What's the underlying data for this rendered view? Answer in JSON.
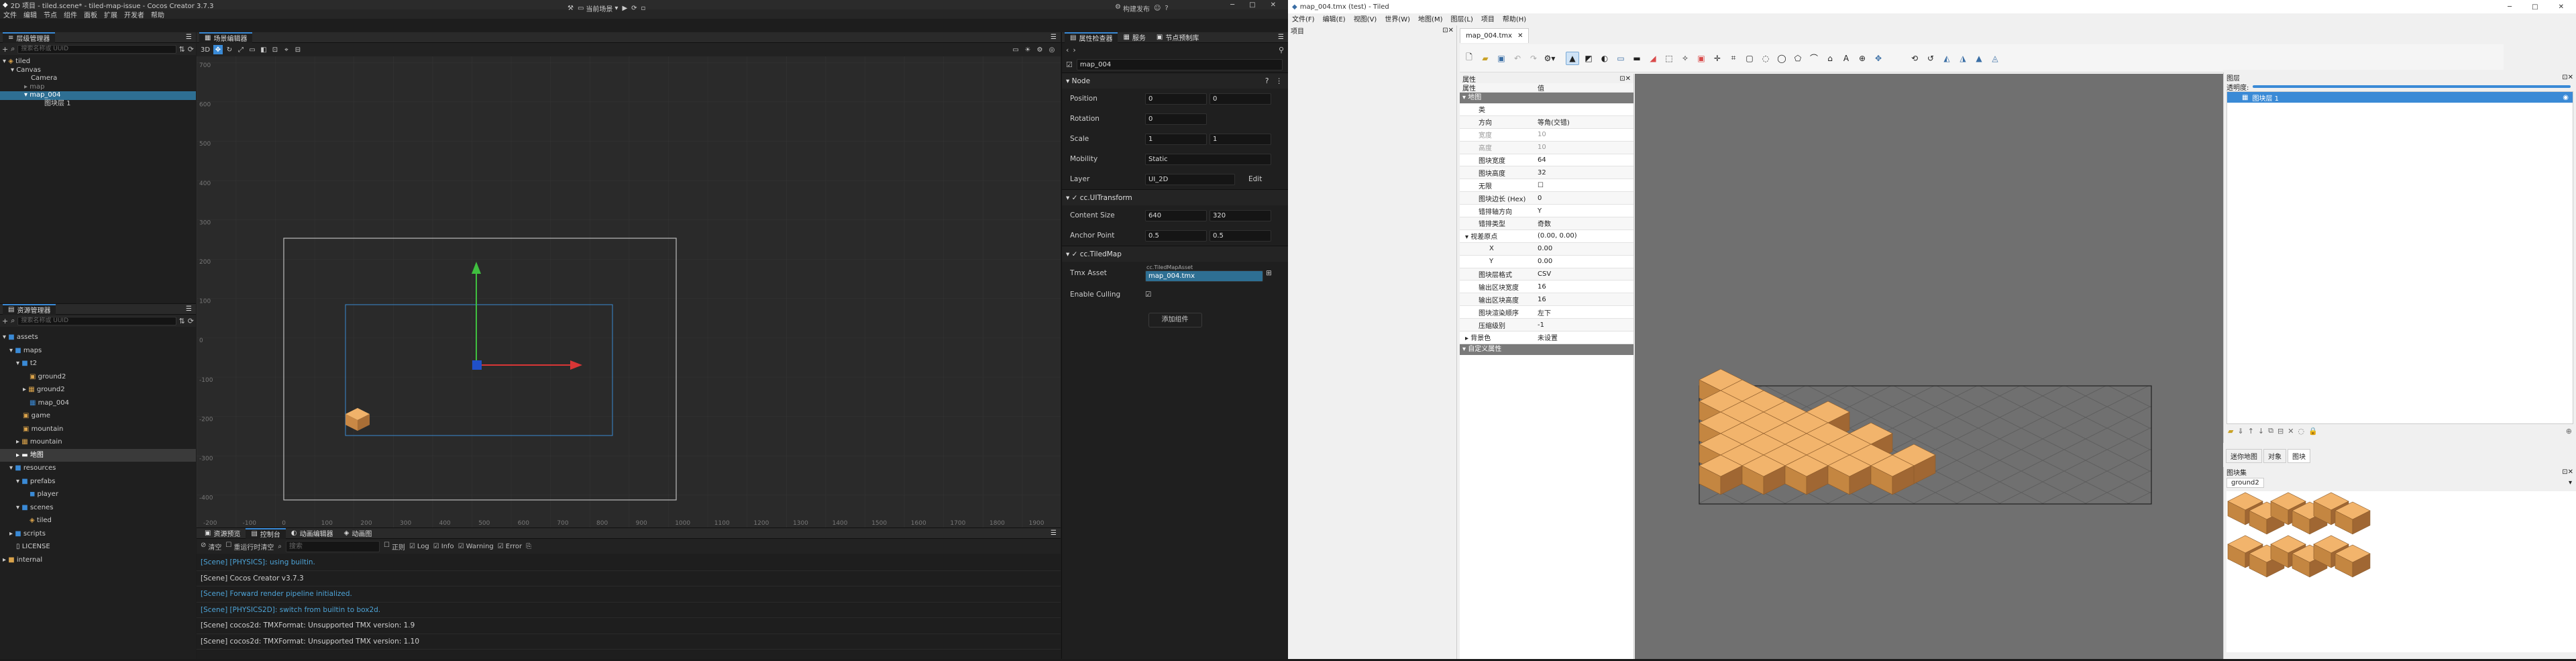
{
  "cocos": {
    "title": "2D 项目 - tiled.scene* - tiled-map-issue - Cocos Creator 3.7.3",
    "menu": [
      "文件",
      "编辑",
      "节点",
      "组件",
      "面板",
      "扩展",
      "开发者",
      "帮助"
    ],
    "scene_select": "当前场景",
    "publish": "构建发布",
    "hierarchy": {
      "title": "层级管理器",
      "search": "搜索名称或 UUID",
      "items": [
        {
          "label": "tiled",
          "lvl": 0
        },
        {
          "label": "Canvas",
          "lvl": 1
        },
        {
          "label": "Camera",
          "lvl": 2
        },
        {
          "label": "map",
          "lvl": 2
        },
        {
          "label": "map_004",
          "lvl": 2,
          "sel": true
        },
        {
          "label": "图块层 1",
          "lvl": 3
        }
      ]
    },
    "scene": {
      "title": "场景编辑器",
      "mode": "3D",
      "yticks": [
        "700",
        "600",
        "500",
        "400",
        "300",
        "200",
        "100",
        "0",
        "-100",
        "-200",
        "-300",
        "-400",
        "-500",
        "-600",
        "-700"
      ],
      "xticks": [
        "-200",
        "-100",
        "0",
        "100",
        "200",
        "300",
        "400",
        "500",
        "600",
        "700",
        "800",
        "900",
        "1000",
        "1100",
        "1200",
        "1300",
        "1400",
        "1500",
        "1600",
        "1700",
        "1800",
        "1900"
      ]
    },
    "assets": {
      "title": "资源管理器",
      "search": "搜索名称或 UUID",
      "items": [
        {
          "label": "assets",
          "lvl": 0
        },
        {
          "label": "maps",
          "lvl": 1
        },
        {
          "label": "t2",
          "lvl": 2
        },
        {
          "label": "ground2",
          "lvl": 3
        },
        {
          "label": "ground2",
          "lvl": 3
        },
        {
          "label": "map_004",
          "lvl": 3
        },
        {
          "label": "game",
          "lvl": 2
        },
        {
          "label": "mountain",
          "lvl": 2
        },
        {
          "label": "mountain",
          "lvl": 2
        },
        {
          "label": "地图",
          "lvl": 2,
          "sel": true
        },
        {
          "label": "resources",
          "lvl": 1
        },
        {
          "label": "prefabs",
          "lvl": 2
        },
        {
          "label": "player",
          "lvl": 3
        },
        {
          "label": "scenes",
          "lvl": 2
        },
        {
          "label": "tiled",
          "lvl": 3
        },
        {
          "label": "scripts",
          "lvl": 1
        },
        {
          "label": "LICENSE",
          "lvl": 1
        },
        {
          "label": "internal",
          "lvl": 0
        }
      ]
    },
    "console": {
      "tabs": [
        "资源预览",
        "控制台",
        "动画编辑器",
        "动画图"
      ],
      "clear": "清空",
      "clear_on_run": "重运行时清空",
      "search": "搜索",
      "regex": "正则",
      "filters": [
        "Log",
        "Info",
        "Warning",
        "Error"
      ],
      "logs": [
        {
          "text": "[Scene] [PHYSICS]: using builtin.",
          "c": "#4da3d6"
        },
        {
          "text": "[Scene] Cocos Creator v3.7.3",
          "c": "#cfcfcf"
        },
        {
          "text": "[Scene] Forward render pipeline initialized.",
          "c": "#4da3d6"
        },
        {
          "text": "[Scene] [PHYSICS2D]: switch from builtin to box2d.",
          "c": "#4da3d6"
        },
        {
          "text": "[Scene] cocos2d: TMXFormat: Unsupported TMX version: 1.9",
          "c": "#cfcfcf"
        },
        {
          "text": "[Scene] cocos2d: TMXFormat: Unsupported TMX version: 1.10",
          "c": "#cfcfcf"
        }
      ]
    },
    "inspector": {
      "tabs": [
        "属性检查器",
        "服务",
        "节点预制库"
      ],
      "node_name": "map_004",
      "node_section": "Node",
      "position": [
        "0",
        "0"
      ],
      "rotation": "0",
      "scale": [
        "1",
        "1"
      ],
      "mobility": "Static",
      "layer": "UI_2D",
      "edit": "Edit",
      "uitransform": "cc.UITransform",
      "content_size": [
        "640",
        "320"
      ],
      "anchor": [
        "0.5",
        "0.5"
      ],
      "tiledmap": "cc.TiledMap",
      "tmx_label": "Tmx Asset",
      "tmx_small": "cc.TiledMapAsset",
      "tmx_value": "map_004.tmx",
      "culling": "Enable Culling",
      "add_component": "添加组件",
      "labels": {
        "position": "Position",
        "rotation": "Rotation",
        "scale": "Scale",
        "mobility": "Mobility",
        "layer": "Layer",
        "content_size": "Content Size",
        "anchor": "Anchor Point",
        "w": "W",
        "h": "H",
        "x": "X",
        "y": "Y"
      }
    }
  },
  "tiled": {
    "title": "map_004.tmx (test) - Tiled",
    "menu": [
      "文件(F)",
      "编辑(E)",
      "视图(V)",
      "世界(W)",
      "地图(M)",
      "图层(L)",
      "项目",
      "帮助(H)"
    ],
    "project": "项目",
    "doc_tab": "map_004.tmx",
    "props": {
      "title": "属性",
      "col_k": "属性",
      "col_v": "值",
      "section": "地图",
      "custom": "自定义属性",
      "rows": [
        {
          "k": "类",
          "v": ""
        },
        {
          "k": "方向",
          "v": "等角(交错)"
        },
        {
          "k": "宽度",
          "v": "10",
          "dis": true
        },
        {
          "k": "高度",
          "v": "10",
          "dis": true
        },
        {
          "k": "图块宽度",
          "v": "64"
        },
        {
          "k": "图块高度",
          "v": "32"
        },
        {
          "k": "无限",
          "v": "☐"
        },
        {
          "k": "图块边长 (Hex)",
          "v": "0"
        },
        {
          "k": "错排轴方向",
          "v": "Y"
        },
        {
          "k": "错排类型",
          "v": "奇数"
        },
        {
          "k": "▾ 视差原点",
          "v": "(0.00, 0.00)"
        },
        {
          "k": "X",
          "v": "0.00",
          "ind": true
        },
        {
          "k": "Y",
          "v": "0.00",
          "ind": true
        },
        {
          "k": "图块层格式",
          "v": "CSV"
        },
        {
          "k": "输出区块宽度",
          "v": "16"
        },
        {
          "k": "输出区块高度",
          "v": "16"
        },
        {
          "k": "图块渲染顺序",
          "v": "左下"
        },
        {
          "k": "压缩级别",
          "v": "-1"
        },
        {
          "k": "▸ 背景色",
          "v": "未设置"
        }
      ]
    },
    "layers": {
      "title": "图层",
      "opacity": "透明度:",
      "item": "图块层 1"
    },
    "lower_tabs": [
      "迷你地图",
      "对象",
      "图块"
    ],
    "tilesets": {
      "title": "图块集",
      "name": "ground2"
    }
  }
}
